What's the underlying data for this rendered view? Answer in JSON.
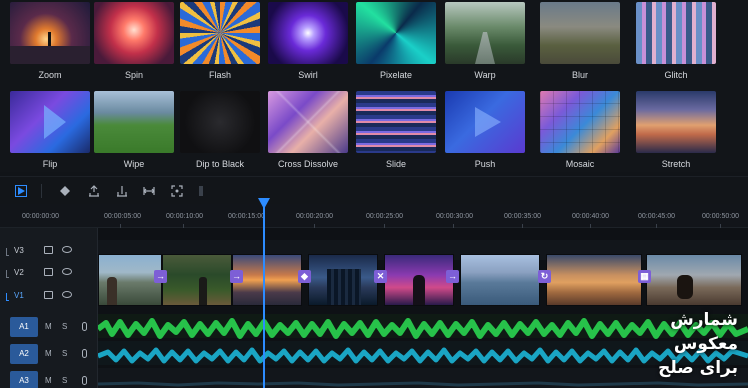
{
  "transitions": [
    {
      "label": "Zoom"
    },
    {
      "label": "Spin"
    },
    {
      "label": "Flash"
    },
    {
      "label": "Swirl"
    },
    {
      "label": "Pixelate"
    },
    {
      "label": "Warp"
    },
    {
      "label": "Blur"
    },
    {
      "label": "Glitch"
    },
    {
      "label": "Flip"
    },
    {
      "label": "Wipe"
    },
    {
      "label": "Dip to Black"
    },
    {
      "label": "Cross Dissolve"
    },
    {
      "label": "Slide"
    },
    {
      "label": "Push"
    },
    {
      "label": "Mosaic"
    },
    {
      "label": "Stretch"
    }
  ],
  "toolbar": {
    "icons": [
      "play-icon",
      "keyframe-icon",
      "split-icon",
      "trim-icon",
      "zoom-fit-icon",
      "snap-icon",
      "marker-icon"
    ]
  },
  "ruler": {
    "timecodes": [
      "00:00:00:00",
      "00:00:05:00",
      "00:00:10:00",
      "00:00:15:00",
      "00:00:20:00",
      "00:00:25:00",
      "00:00:30:00",
      "00:00:35:00",
      "00:00:40:00",
      "00:00:45:00",
      "00:00:50:00"
    ]
  },
  "tracks": {
    "video": [
      {
        "name": "V3"
      },
      {
        "name": "V2"
      },
      {
        "name": "V1"
      }
    ],
    "audio": [
      {
        "name": "A1",
        "mute": "M",
        "solo": "S"
      },
      {
        "name": "A2",
        "mute": "M",
        "solo": "S"
      },
      {
        "name": "A3",
        "mute": "M",
        "solo": "S"
      }
    ]
  },
  "transition_markers": [
    "→",
    "→",
    "◆",
    "✕",
    "→",
    "↻",
    "▦"
  ],
  "overlay": {
    "line1": "شمارش",
    "line2": "معکوس",
    "line3": "برای صلح"
  },
  "colors": {
    "accent": "#2d8cff",
    "transition_marker": "#7d5fd6",
    "audio_a1": "#27c24a",
    "audio_a2": "#1aa5c4",
    "audio_badge": "#2a5a9a"
  }
}
